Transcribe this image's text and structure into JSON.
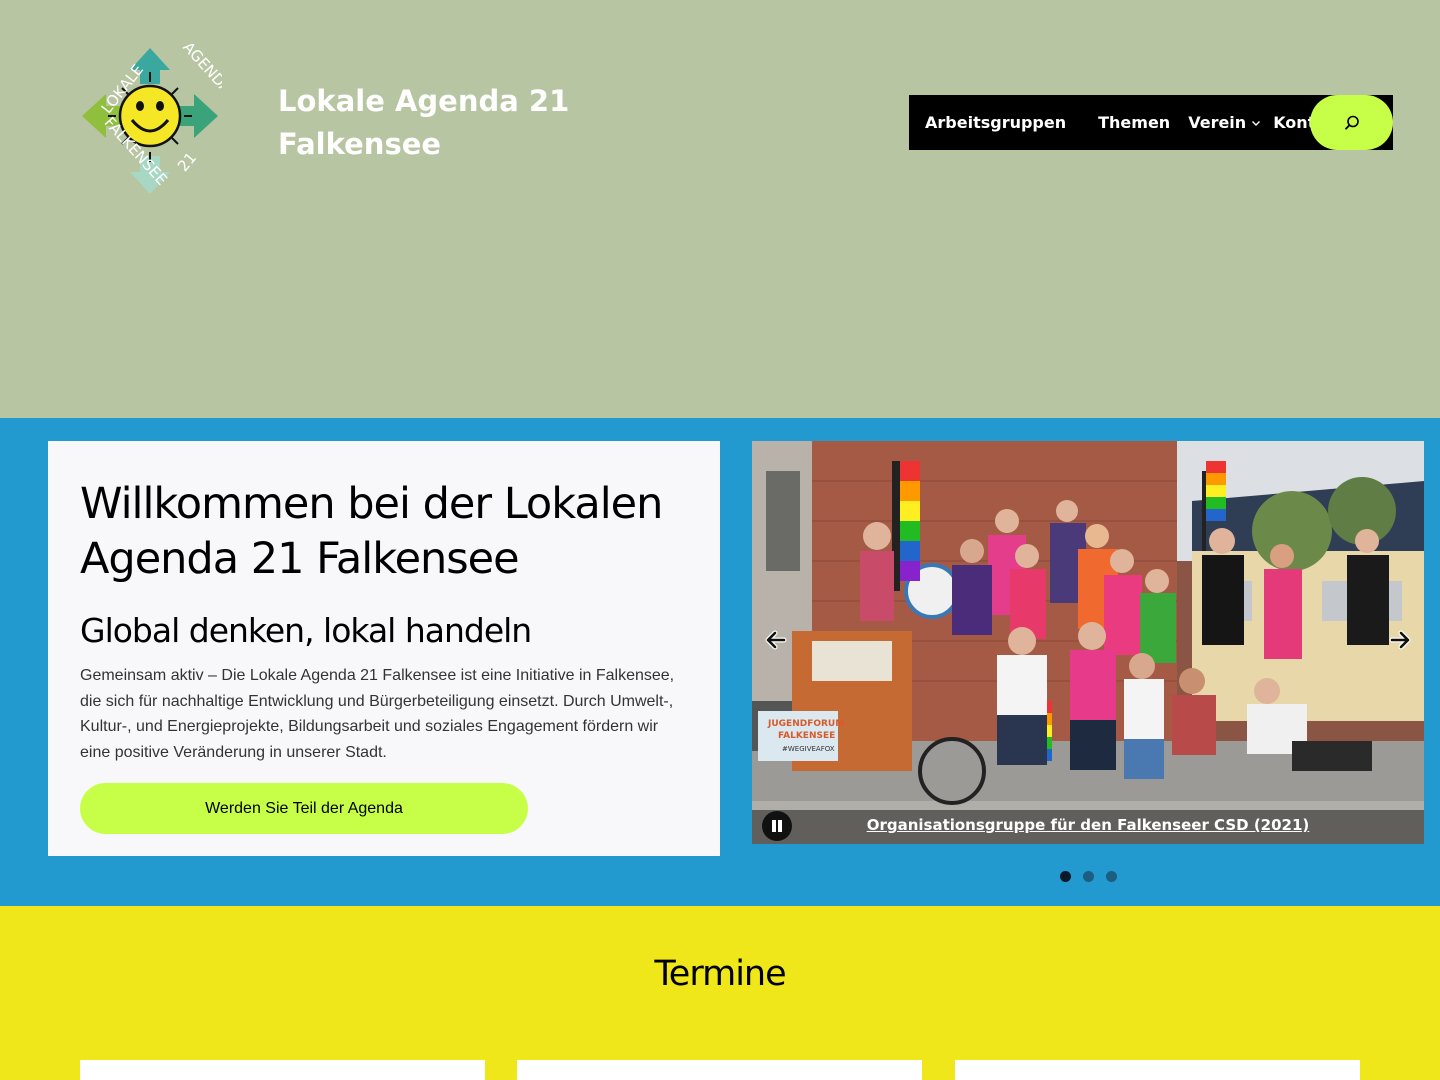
{
  "header": {
    "logo": {
      "alt": "Lokale Agenda 21 Falkensee Logo",
      "text_top_left": "LOKALE",
      "text_top_right": "AGENDA",
      "text_bottom_left": "FALKENSEE",
      "text_bottom_right": "21"
    },
    "site_title_line1": "Lokale Agenda 21",
    "site_title_line2": "Falkensee",
    "nav": {
      "items": [
        {
          "label": "Arbeitsgruppen"
        },
        {
          "label": "Themen"
        },
        {
          "label": "Verein",
          "has_submenu": true
        },
        {
          "label": "Kontakt"
        }
      ],
      "search_icon": "search-icon"
    }
  },
  "hero": {
    "title": "Willkommen bei der Lokalen Agenda 21 Falkensee",
    "subtitle": "Global denken, lokal handeln",
    "text": "Gemeinsam aktiv – Die Lokale Agenda 21 Falkensee ist eine Initiative in Falkensee, die sich für nachhaltige Entwicklung und Bürgerbeteiligung einsetzt. Durch Umwelt-, Kultur-, und Energieprojekte, Bildungsarbeit und soziales Engagement fördern wir eine positive Veränderung in unserer Stadt.",
    "cta_label": "Werden Sie Teil der Agenda"
  },
  "slider": {
    "caption": "Organisationsgruppe für den Falkenseer CSD (2021)",
    "bike_sign_line1": "JUGENDFORUM",
    "bike_sign_line2": "FALKENSEE",
    "bike_sign_tag": "#WEGIVEAFOX",
    "active_slide": 1,
    "slide_count": 3
  },
  "events": {
    "title": "Termine"
  },
  "colors": {
    "header_bg": "#b8c5a2",
    "hero_bg": "#2299cf",
    "events_bg": "#f0e71b",
    "accent": "#c7ff48"
  }
}
